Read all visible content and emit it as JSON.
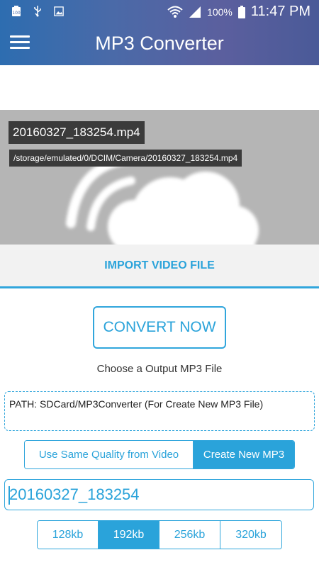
{
  "status_bar": {
    "battery_text": "100%",
    "time": "11:47 PM",
    "icons": [
      "battery-100-icon",
      "usb-icon",
      "gallery-icon",
      "wifi-icon",
      "signal-icon",
      "battery-icon"
    ]
  },
  "toolbar": {
    "title": "MP3 Converter",
    "menu_icon": "hamburger-menu-icon"
  },
  "preview": {
    "file_name": "20160327_183254.mp4",
    "file_path": "/storage/emulated/0/DCIM/Camera/20160327_183254.mp4",
    "placeholder_icon": "cloud-wifi-icon"
  },
  "import_label": "IMPORT VIDEO FILE",
  "convert_label": "CONVERT NOW",
  "choose_label": "Choose a Output MP3 File",
  "path_text": "PATH: SDCard/MP3Converter (For Create New MP3 File)",
  "mode": {
    "options": [
      "Use Same Quality from Video",
      "Create New MP3"
    ],
    "selected": "Create New MP3"
  },
  "output_filename": "20160327_183254",
  "bitrates": {
    "options": [
      "128kb",
      "192kb",
      "256kb",
      "320kb"
    ],
    "selected": "192kb"
  },
  "colors": {
    "accent": "#2aa3da",
    "preview_bg": "#b5b5b5",
    "tag_bg": "#3b3b3b"
  }
}
